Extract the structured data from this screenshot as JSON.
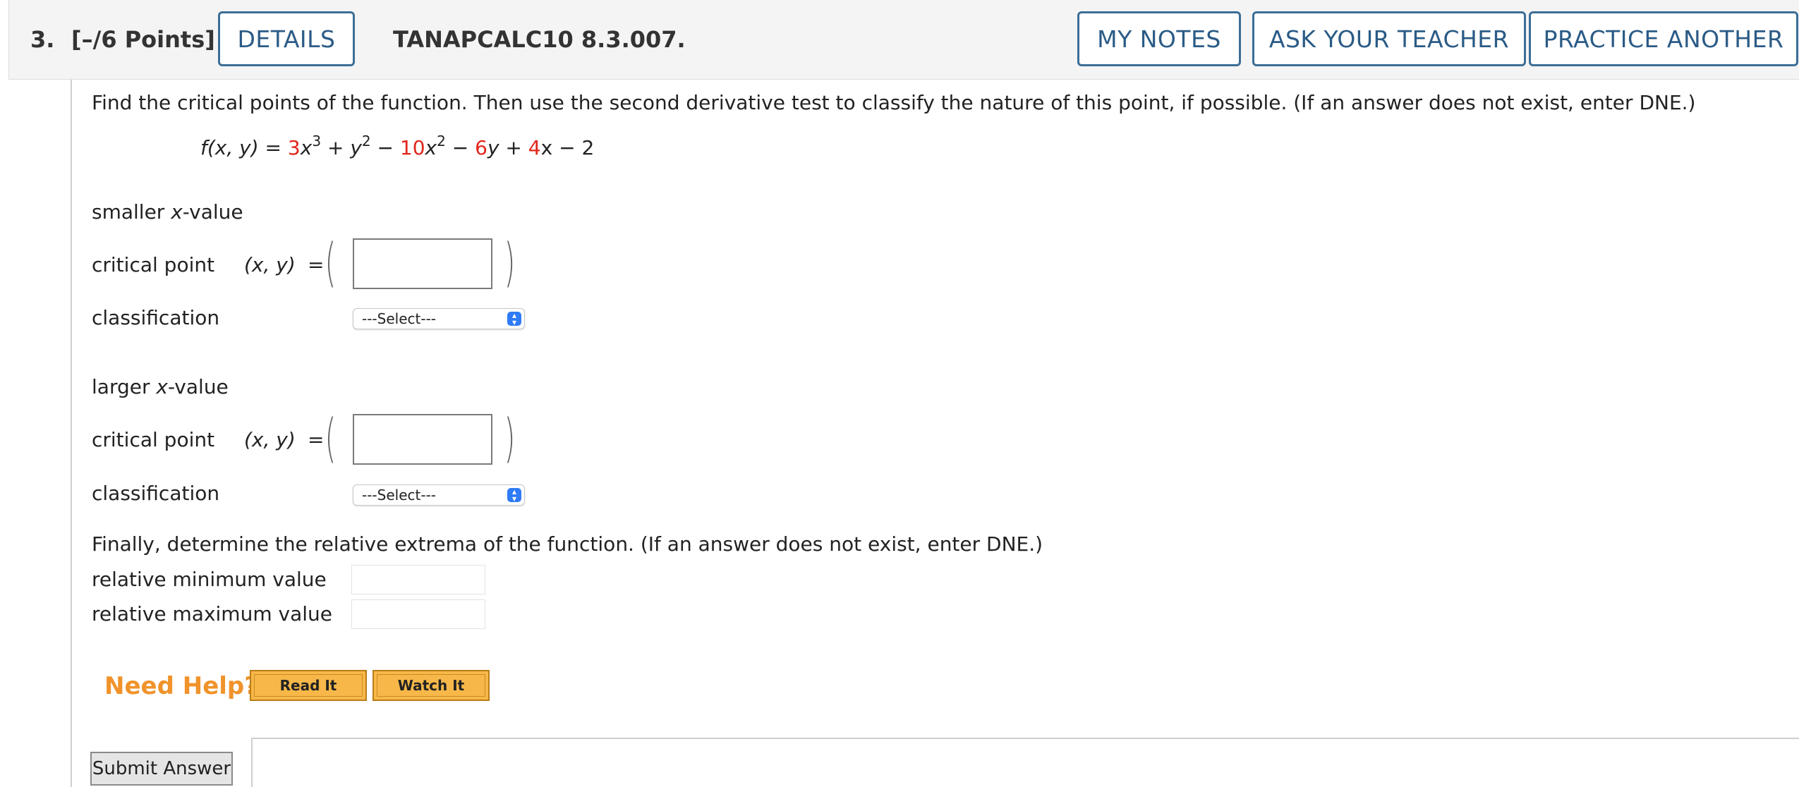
{
  "header": {
    "question_number": "3.",
    "points": "[–/6 Points]",
    "details_label": "DETAILS",
    "problem_code": "TANAPCALC10 8.3.007.",
    "my_notes_label": "MY NOTES",
    "ask_teacher_label": "ASK YOUR TEACHER",
    "practice_label": "PRACTICE ANOTHER"
  },
  "instructions": "Find the critical points of the function. Then use the second derivative test to classify the nature of this point, if possible. (If an answer does not exist, enter DNE.)",
  "function": {
    "lhs": "f(x, y) = ",
    "c1": "3",
    "t1": "x",
    "e1": "3",
    "t2": " + y",
    "e2": "2",
    "t3": " − ",
    "c2": "10",
    "t4": "x",
    "e3": "2",
    "t5": " − ",
    "c3": "6",
    "t6": "y + ",
    "c4": "4",
    "t7": "x − 2"
  },
  "smaller": {
    "heading_prefix": "smaller ",
    "heading_var": "x",
    "heading_suffix": "-value",
    "critical_label": "critical point",
    "xy_label": "(x, y)",
    "equals": "=",
    "classification_label": "classification",
    "select_value": "---Select---"
  },
  "larger": {
    "heading_prefix": "larger ",
    "heading_var": "x",
    "heading_suffix": "-value",
    "critical_label": "critical point",
    "xy_label": "(x, y)",
    "equals": "=",
    "classification_label": "classification",
    "select_value": "---Select---"
  },
  "extrema": {
    "instructions": "Finally, determine the relative extrema of the function. (If an answer does not exist, enter DNE.)",
    "min_label": "relative minimum value",
    "max_label": "relative maximum value"
  },
  "help": {
    "label": "Need Help?",
    "read_label": "Read It",
    "watch_label": "Watch It"
  },
  "submit_label": "Submit Answer",
  "colors": {
    "accent_blue": "#2b5b86",
    "coefficient_red": "#e1261c",
    "help_orange": "#f0932b",
    "help_button": "#f7b849"
  }
}
